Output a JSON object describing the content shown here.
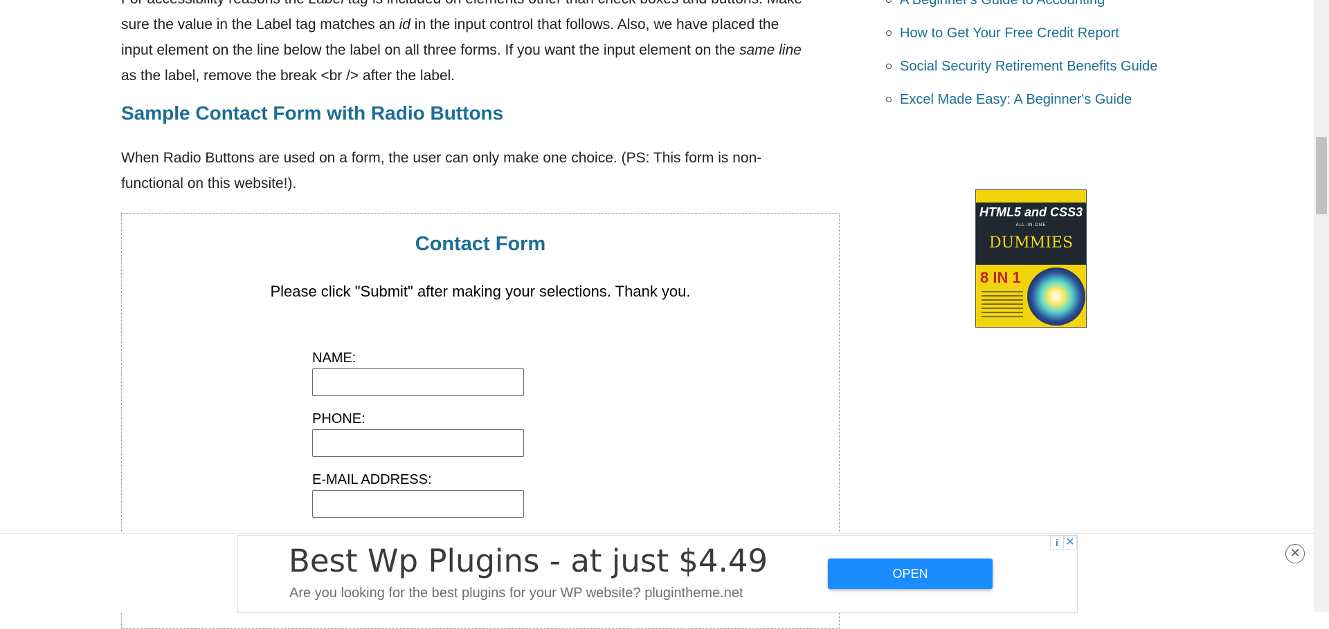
{
  "article": {
    "para1": {
      "line0_a": "For accessibility reasons the ",
      "line0_em": "Label tag",
      "line0_b": " is included on elements other than check boxes and buttons. Make",
      "line1_a": "sure the value in the Label tag matches an ",
      "line1_em": "id",
      "line1_b": " in the input control that follows. Also, we have placed the",
      "line2_a": "input element on the line below the label on all three forms. If you want the input element on the ",
      "line2_em": "same line",
      "line3": "as the label, remove the break <br /> after the label."
    },
    "heading": "Sample Contact Form with Radio Buttons",
    "para2_line1": "When Radio Buttons are used on a form, the user can only make one choice. (PS: This form is non-",
    "para2_line2": "functional on this website!)."
  },
  "form": {
    "title": "Contact Form",
    "instructions": "Please click \"Submit\" after making your selections. Thank you.",
    "fields": [
      {
        "label": "NAME:",
        "value": ""
      },
      {
        "label": "PHONE:",
        "value": ""
      },
      {
        "label": "E-MAIL ADDRESS:",
        "value": ""
      }
    ]
  },
  "sidebar": {
    "links": [
      "A Beginner's Guide to Accounting",
      "How to Get Your Free Credit Report",
      "Social Security Retirement Benefits Guide",
      "Excel Made Easy: A Beginner's Guide"
    ],
    "book": {
      "title": "HTML5 and CSS3",
      "subtitle": "ALL-IN-ONE",
      "series": "DUMMIES",
      "badge": "8 IN 1"
    }
  },
  "ad": {
    "headline": "Best Wp Plugins - at just $4.49",
    "description": "Are you looking for the best plugins for your WP website? plugintheme.net",
    "open_label": "OPEN",
    "info_icon": "i",
    "x_icon": "✕",
    "close_icon": "✕"
  }
}
